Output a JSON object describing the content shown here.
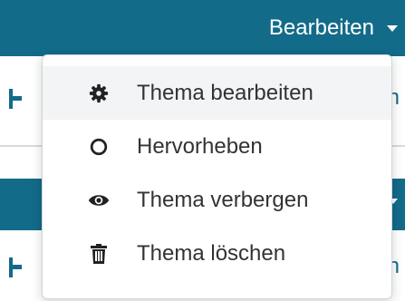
{
  "toolbar": {
    "edit_label": "Bearbeiten"
  },
  "rows": {
    "first_letter": "n",
    "second_letter": "n"
  },
  "menu": {
    "items": [
      {
        "label": "Thema bearbeiten",
        "icon": "gear-icon"
      },
      {
        "label": "Hervorheben",
        "icon": "circle-outline-icon"
      },
      {
        "label": "Thema verbergen",
        "icon": "eye-icon"
      },
      {
        "label": "Thema löschen",
        "icon": "trash-icon"
      }
    ]
  },
  "colors": {
    "header": "#136b8a",
    "hover": "#f3f4f5",
    "text": "#333333"
  }
}
